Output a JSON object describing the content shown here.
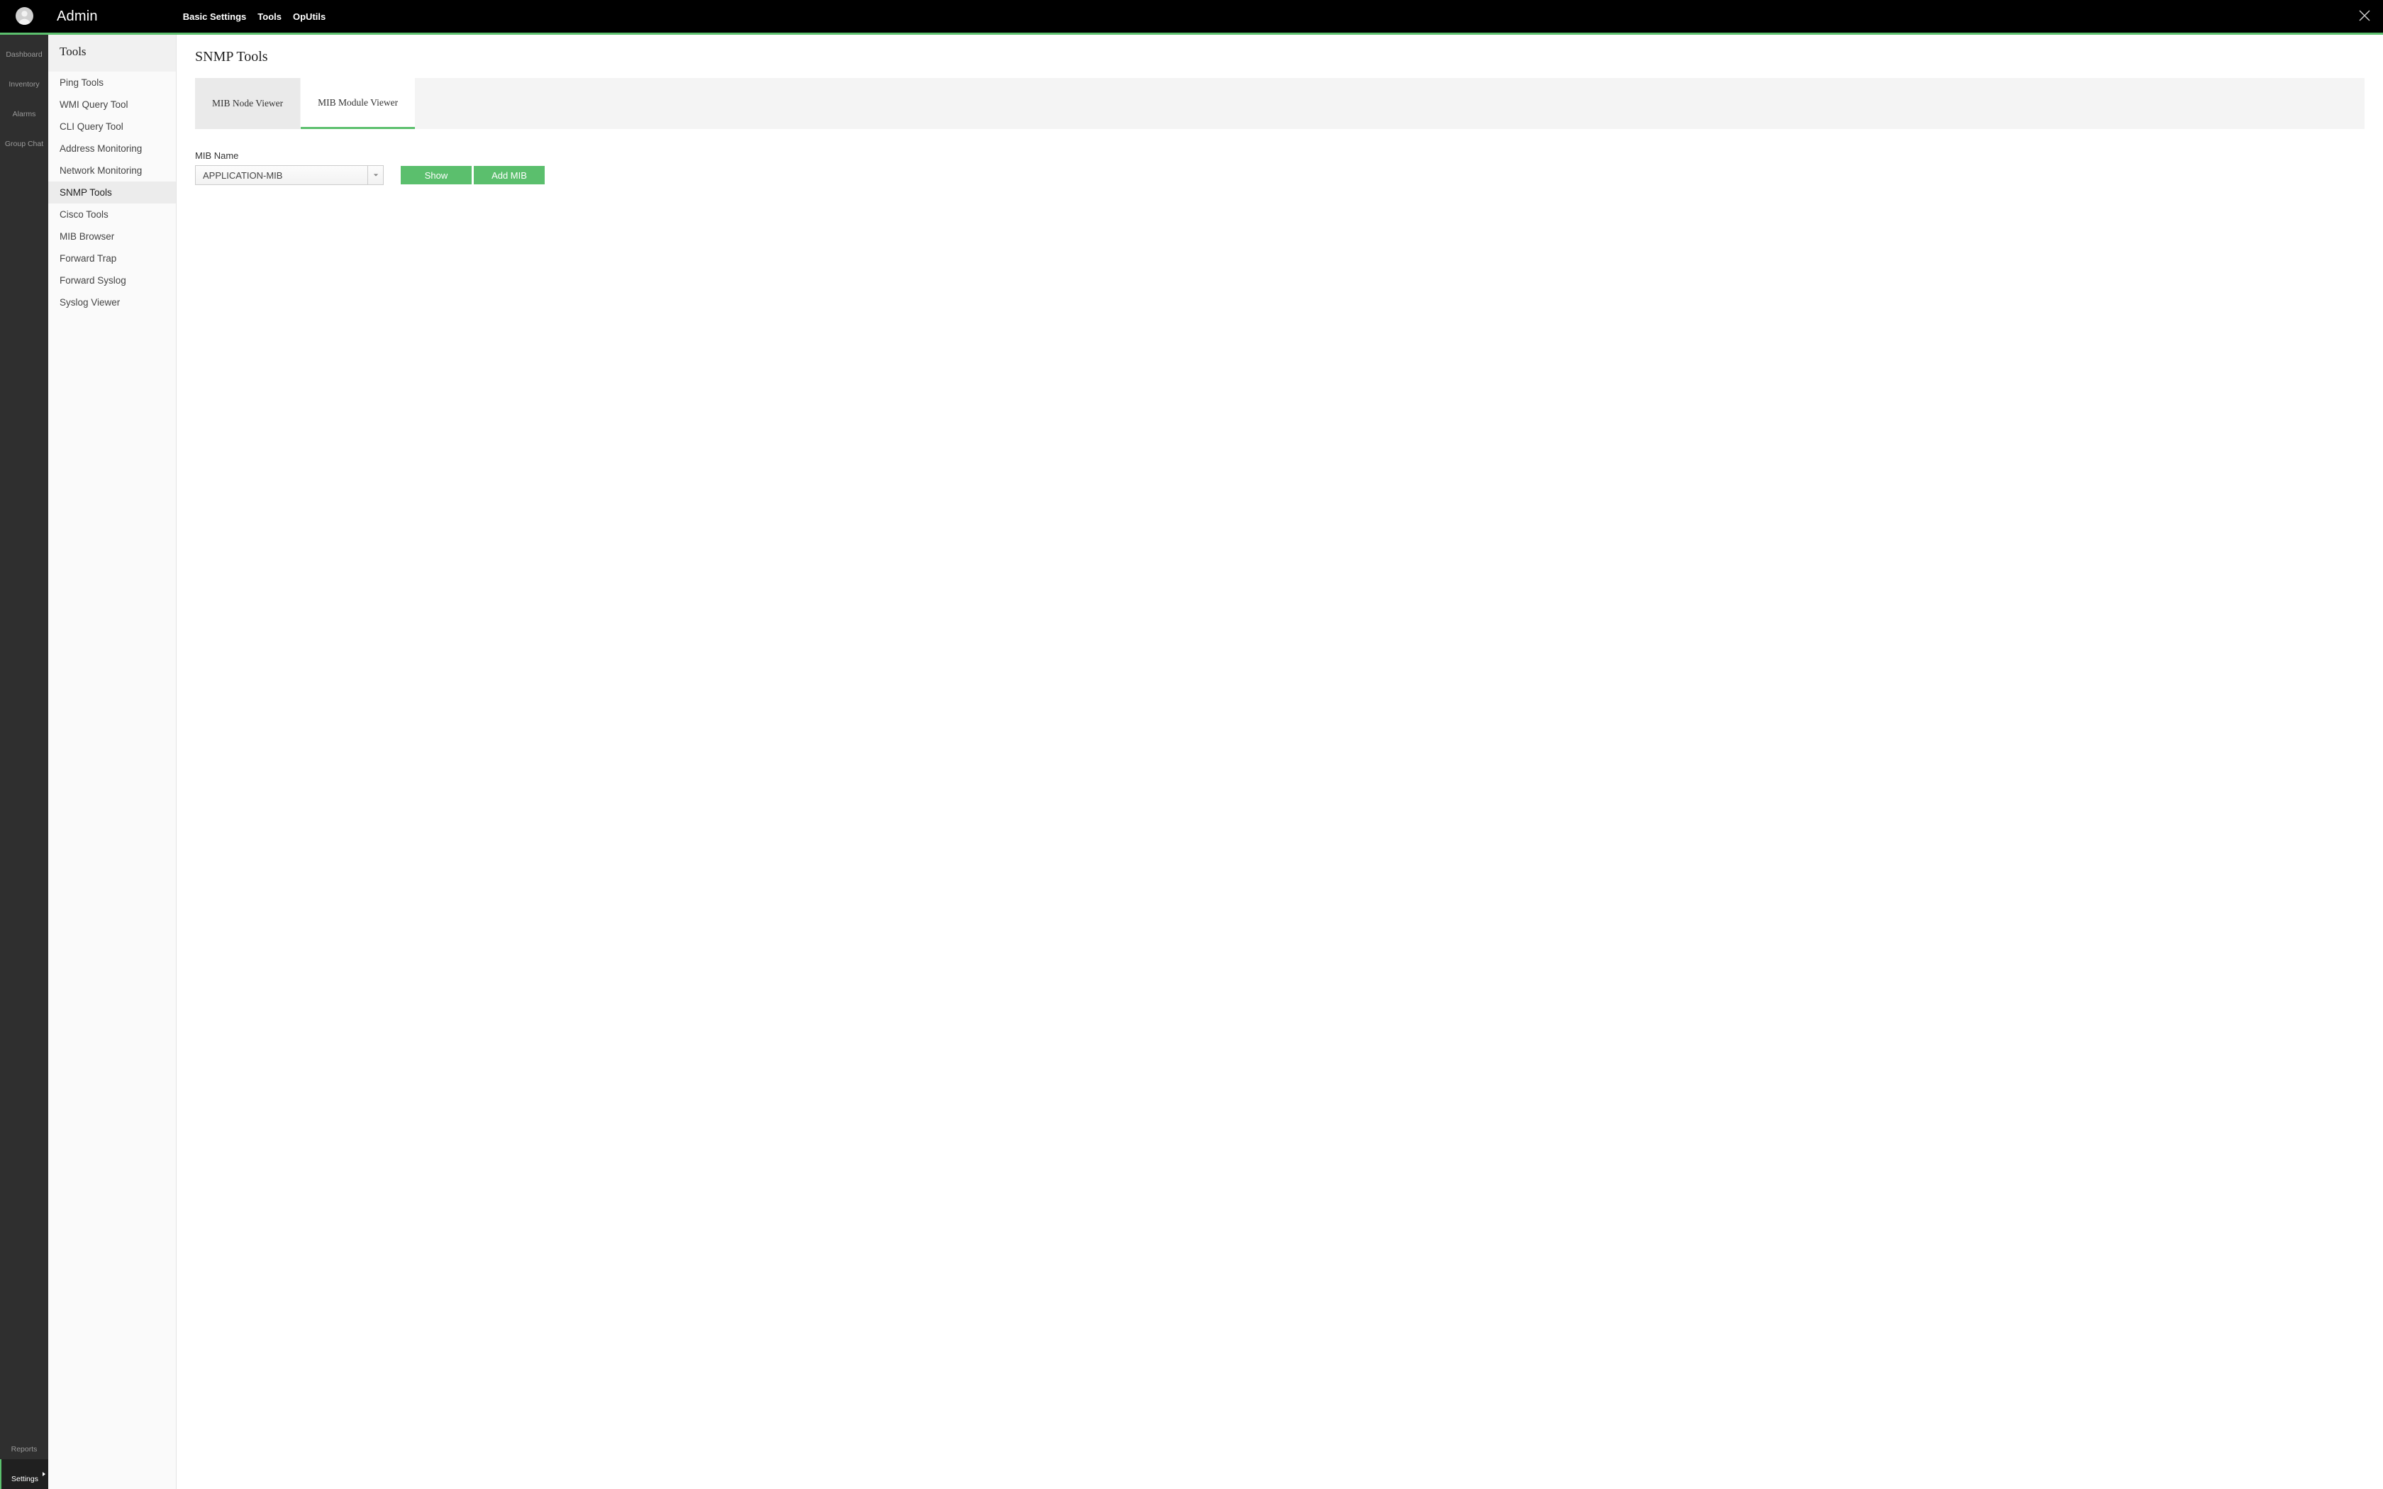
{
  "colors": {
    "accent": "#5bbf6d"
  },
  "topbar": {
    "title": "Admin",
    "nav": [
      "Basic Settings",
      "Tools",
      "OpUtils"
    ]
  },
  "rail": {
    "top": [
      "Dashboard",
      "Inventory",
      "Alarms",
      "Group Chat"
    ],
    "bottom": [
      "Reports",
      "Settings"
    ],
    "active": "Settings"
  },
  "sidebar": {
    "title": "Tools",
    "items": [
      "Ping Tools",
      "WMI Query Tool",
      "CLI Query Tool",
      "Address Monitoring",
      "Network Monitoring",
      "SNMP Tools",
      "Cisco Tools",
      "MIB Browser",
      "Forward Trap",
      "Forward Syslog",
      "Syslog Viewer"
    ],
    "active": "SNMP Tools"
  },
  "main": {
    "title": "SNMP Tools",
    "tabs": [
      "MIB Node Viewer",
      "MIB Module Viewer"
    ],
    "active_tab": "MIB Module Viewer",
    "form": {
      "mib_name_label": "MIB Name",
      "mib_name_value": "APPLICATION-MIB",
      "show_label": "Show",
      "add_mib_label": "Add MIB"
    }
  }
}
